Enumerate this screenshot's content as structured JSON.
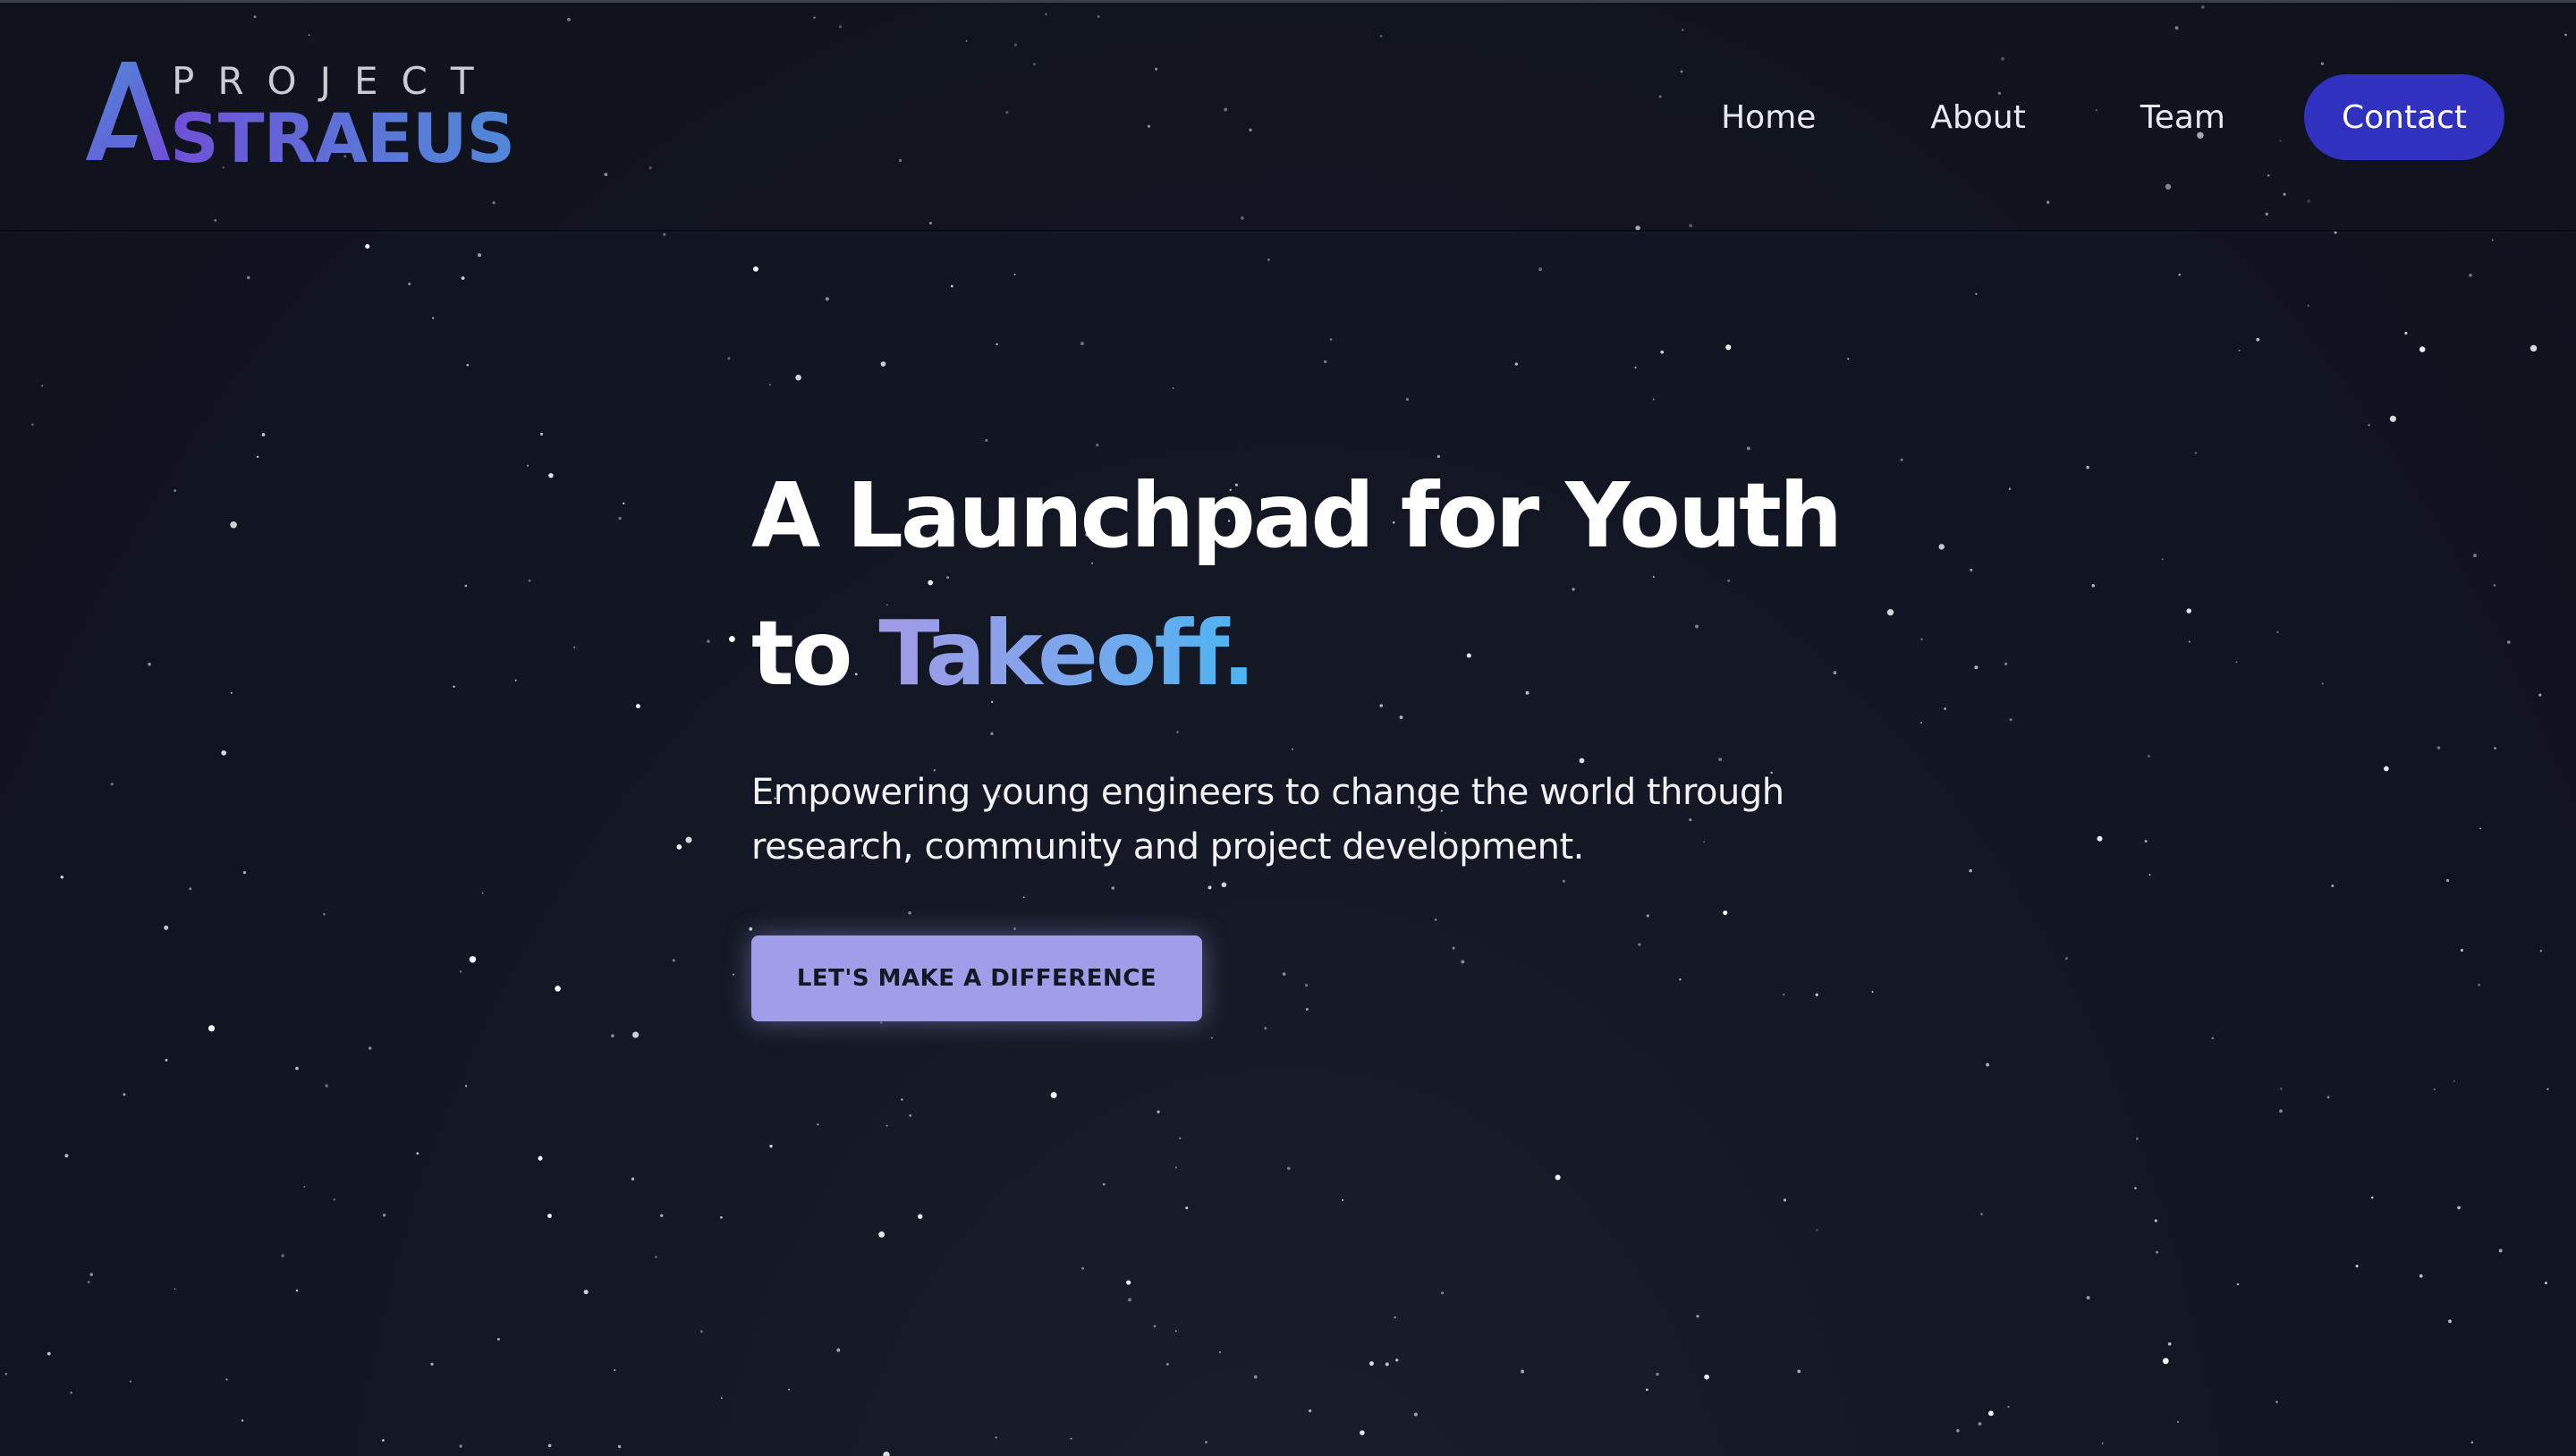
{
  "header": {
    "logo": {
      "line1": "PROJECT",
      "line2": "STRAEUS",
      "mark_icon": "astraeus-a-logo-icon"
    },
    "nav": {
      "home": "Home",
      "about": "About",
      "team": "Team",
      "contact": "Contact"
    }
  },
  "hero": {
    "headline_line1": "A Launchpad for Youth",
    "headline_line2_prefix": "to ",
    "headline_line2_accent": "Takeoff.",
    "subtitle": "Empowering young engineers to change the world through research, community and project development.",
    "cta_label": "LET'S MAKE A DIFFERENCE"
  },
  "colors": {
    "background": "#10131e",
    "contact_button": "#3131c0",
    "cta_button": "#a09ee8",
    "accent_start": "#a39ae6",
    "accent_end": "#4ab5f2",
    "logo_gradient_start": "#6f4fd8",
    "logo_gradient_end": "#4f8ad8"
  }
}
